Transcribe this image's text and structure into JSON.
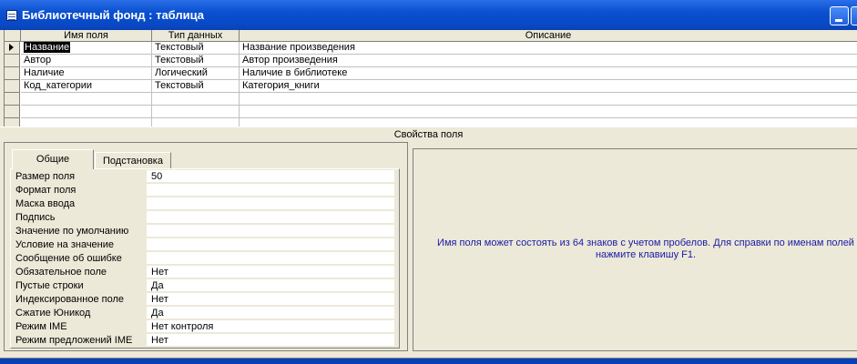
{
  "window": {
    "title": "Библиотечный фонд : таблица"
  },
  "grid": {
    "columns": [
      "Имя поля",
      "Тип данных",
      "Описание"
    ],
    "rows": [
      {
        "name": "Название",
        "type": "Текстовый",
        "desc": "Название произведения"
      },
      {
        "name": "Автор",
        "type": "Текстовый",
        "desc": "Автор произведения"
      },
      {
        "name": "Наличие",
        "type": "Логический",
        "desc": "Наличие в библиотеке"
      },
      {
        "name": "Код_категории",
        "type": "Текстовый",
        "desc": "Категория_книги"
      },
      {
        "name": "",
        "type": "",
        "desc": ""
      },
      {
        "name": "",
        "type": "",
        "desc": ""
      },
      {
        "name": "",
        "type": "",
        "desc": ""
      }
    ]
  },
  "field_properties": {
    "header": "Свойства поля",
    "tabs": [
      "Общие",
      "Подстановка"
    ],
    "active_tab": "Общие",
    "properties": [
      {
        "label": "Размер поля",
        "value": "50"
      },
      {
        "label": "Формат поля",
        "value": ""
      },
      {
        "label": "Маска ввода",
        "value": ""
      },
      {
        "label": "Подпись",
        "value": ""
      },
      {
        "label": "Значение по умолчанию",
        "value": ""
      },
      {
        "label": "Условие на значение",
        "value": ""
      },
      {
        "label": "Сообщение об ошибке",
        "value": ""
      },
      {
        "label": "Обязательное поле",
        "value": "Нет"
      },
      {
        "label": "Пустые строки",
        "value": "Да"
      },
      {
        "label": "Индексированное поле",
        "value": "Нет"
      },
      {
        "label": "Сжатие Юникод",
        "value": "Да"
      },
      {
        "label": "Режим IME",
        "value": "Нет контроля"
      },
      {
        "label": "Режим предложений IME",
        "value": "Нет"
      }
    ],
    "help_text": "Имя поля может состоять из 64 знаков с учетом пробелов.  Для справки по именам полей нажмите клавишу F1."
  },
  "colors": {
    "title_bar": "#0a50d0",
    "help_text": "#1a1aa8",
    "window_bg": "#ece9d8"
  },
  "icons": {
    "window": "table-icon",
    "minimize": "minimize-icon",
    "row_selector": "arrow-right-icon"
  }
}
